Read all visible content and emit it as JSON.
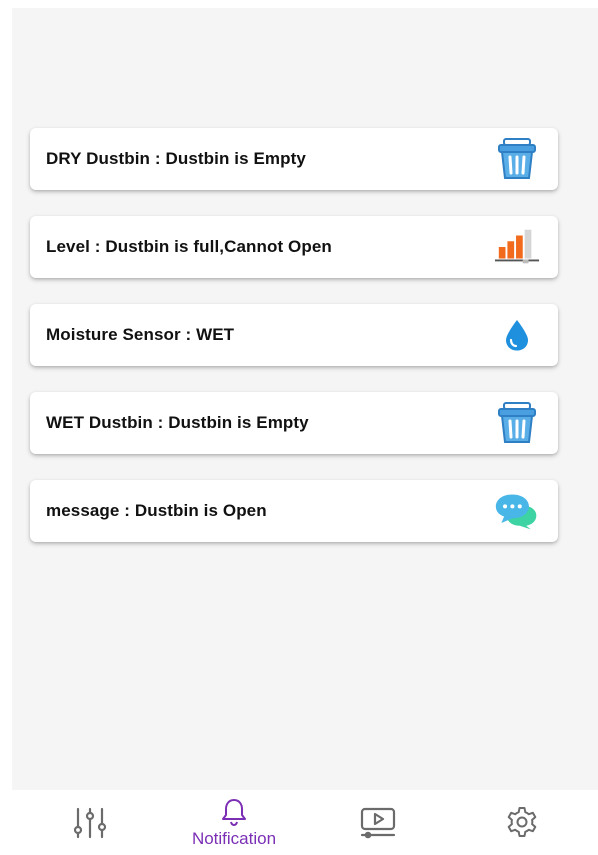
{
  "notifications": [
    {
      "text": "DRY Dustbin : Dustbin is Empty",
      "icon": "trash-bin-icon"
    },
    {
      "text": "Level : Dustbin is full,Cannot Open",
      "icon": "level-bars-icon"
    },
    {
      "text": "Moisture Sensor : WET",
      "icon": "water-drop-icon"
    },
    {
      "text": "WET Dustbin : Dustbin is Empty",
      "icon": "trash-bin-icon"
    },
    {
      "text": "message : Dustbin is Open",
      "icon": "chat-bubble-icon"
    }
  ],
  "nav": {
    "active": "notification",
    "items": [
      {
        "id": "controls",
        "icon": "sliders-icon",
        "label": ""
      },
      {
        "id": "notification",
        "icon": "bell-icon",
        "label": "Notification"
      },
      {
        "id": "video",
        "icon": "video-player-icon",
        "label": ""
      },
      {
        "id": "settings",
        "icon": "gear-icon",
        "label": ""
      }
    ]
  },
  "colors": {
    "accent": "#7b2fb5",
    "trash_blue": "#4a9fe0",
    "level_orange": "#f26b1d",
    "drop_blue": "#1e90dd",
    "chat_blue": "#49b6e8",
    "chat_green": "#3dd3a2",
    "nav_gray": "#6b6b6b"
  }
}
